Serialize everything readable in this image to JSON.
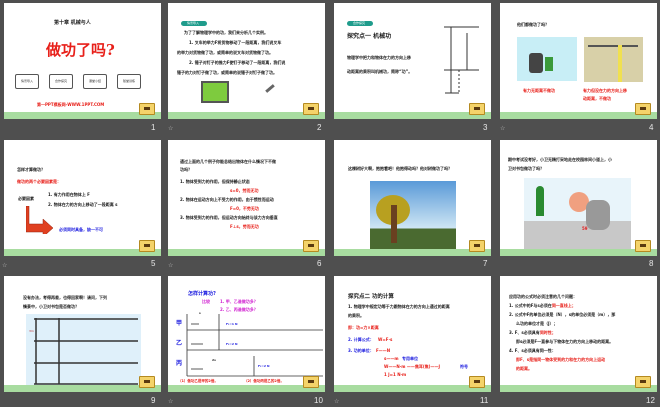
{
  "slides": [
    {
      "number": "1",
      "chapter": "第十章  机械与人",
      "title": "做功了吗?",
      "steps": [
        "情景导入",
        "合作探究",
        "课堂小结",
        "随堂训练"
      ],
      "footer": "第一PPT模板网-WWW.1PPT.COM"
    },
    {
      "number": "2",
      "tag": "情景导入",
      "lines": [
        "为了了解物理学中的功，我们来分析几个实例。",
        "1. 叉车的举力F将货物移动了一段距离，我们说叉车",
        "的举力对货物做了功，或简单的说叉车对货物做了功。",
        "2. 锤子对钉子的推力F使钉子移动了一段距离，我们说",
        "锤子的力对钉子做了功，或简单的说锤子对钉子做了功。"
      ]
    },
    {
      "number": "3",
      "tag": "合作探究",
      "heading": "探究点一  机械功",
      "lines": [
        "物理学中把力和物体在力的方向上移",
        "动距离的乘积叫机械功，简称“功”。"
      ]
    },
    {
      "number": "4",
      "question": "他们都做功了吗？",
      "cap1": "有力无距离不做功",
      "cap2": [
        "有力但没在力的方向上移",
        "动距离，不做功"
      ]
    },
    {
      "number": "5",
      "q": "怎样才算做功？",
      "red": "做功的两个必要因素是：",
      "label": "必要因素",
      "f1": "1. 有力作用在物体上 F",
      "f2": "2. 物体在力的方向上移动了一段距离 s",
      "blue": "必须同时具备，缺一不可"
    },
    {
      "number": "6",
      "lines": [
        "通过上面的几个例子你能总结出物体在什么情况下不做",
        "功吗？"
      ],
      "items": [
        "1.  物体受到力的作用，但保持静止状态",
        "2. 物体在运动方向上不受力的作用，由于惯性而运动",
        "3. 物体受到力的作用，但运动方向始终与该力方向垂直"
      ],
      "notes": [
        "s=0，劳而无功",
        "F=0，不劳无功",
        "F⊥s，劳而无功"
      ]
    },
    {
      "number": "7",
      "question": "这棵树好大啊，抱抱看吧！他抱得动吗？他对树做功了吗？"
    },
    {
      "number": "8",
      "lines": [
        "期中考试没考好，小卫无精打采地走在校园林间小道上，小",
        "卫对书包做功了吗？"
      ],
      "score": "59"
    },
    {
      "number": "9",
      "lines": [
        "没有办法，考得再差，也得回家啊！请问，下列",
        "情景中，小卫对书包是否做功？"
      ],
      "floor": "3m"
    },
    {
      "number": "10",
      "title": "怎样计算功?",
      "compare": "比较",
      "c1": "1. 甲、乙谁做功多？",
      "c2": "2. 乙、丙谁做功多？",
      "rows": [
        "甲",
        "乙",
        "丙"
      ],
      "forces": [
        "F₁=1 N",
        "F₂=2 N",
        "F₃=2 N"
      ],
      "dist": [
        "s",
        "2s"
      ],
      "conclusion": [
        "（1）做功乙是甲的2倍。",
        "（2）做功丙是乙的2倍。"
      ]
    },
    {
      "number": "11",
      "heading": "探究点二  功的计算",
      "def": [
        "1. 物理学中规定功等于力跟物体在力的方向上通过的距离",
        "的乘积。"
      ],
      "formula_text": "即：功=力×距离",
      "calc": "2. 计算公式：",
      "calc_red": "W=F·s",
      "unit": "3. 功的单位：",
      "u1": "F——N",
      "u2": "s——m",
      "u2b": "专用单位",
      "u3": "W——N·m ——焦耳(焦)——J",
      "u3b": "符号",
      "u4": "1 J=1 N·m"
    },
    {
      "number": "12",
      "lines": [
        "应用功的公式时必须注意的几个问题：",
        "1. 公式中的F与s必须在",
        "2. 公式中F的单位必须是（N），s的单位必须是（m），那",
        "么功的单位才是（J）；",
        "3. F、s必须具有",
        "即s必须是F一直参与下物体在力的方向上移动的距离。",
        "4. F、s必须具有同一性：",
        "即F、s是指同一物体受到的力和在力的方向上运动",
        "的距离。"
      ],
      "reds": [
        "同一直线上；",
        "同时性；"
      ]
    }
  ],
  "colors": {
    "background": "#4f4f4f",
    "accent_red": "#e8201a",
    "ground": "#a8dca0"
  }
}
